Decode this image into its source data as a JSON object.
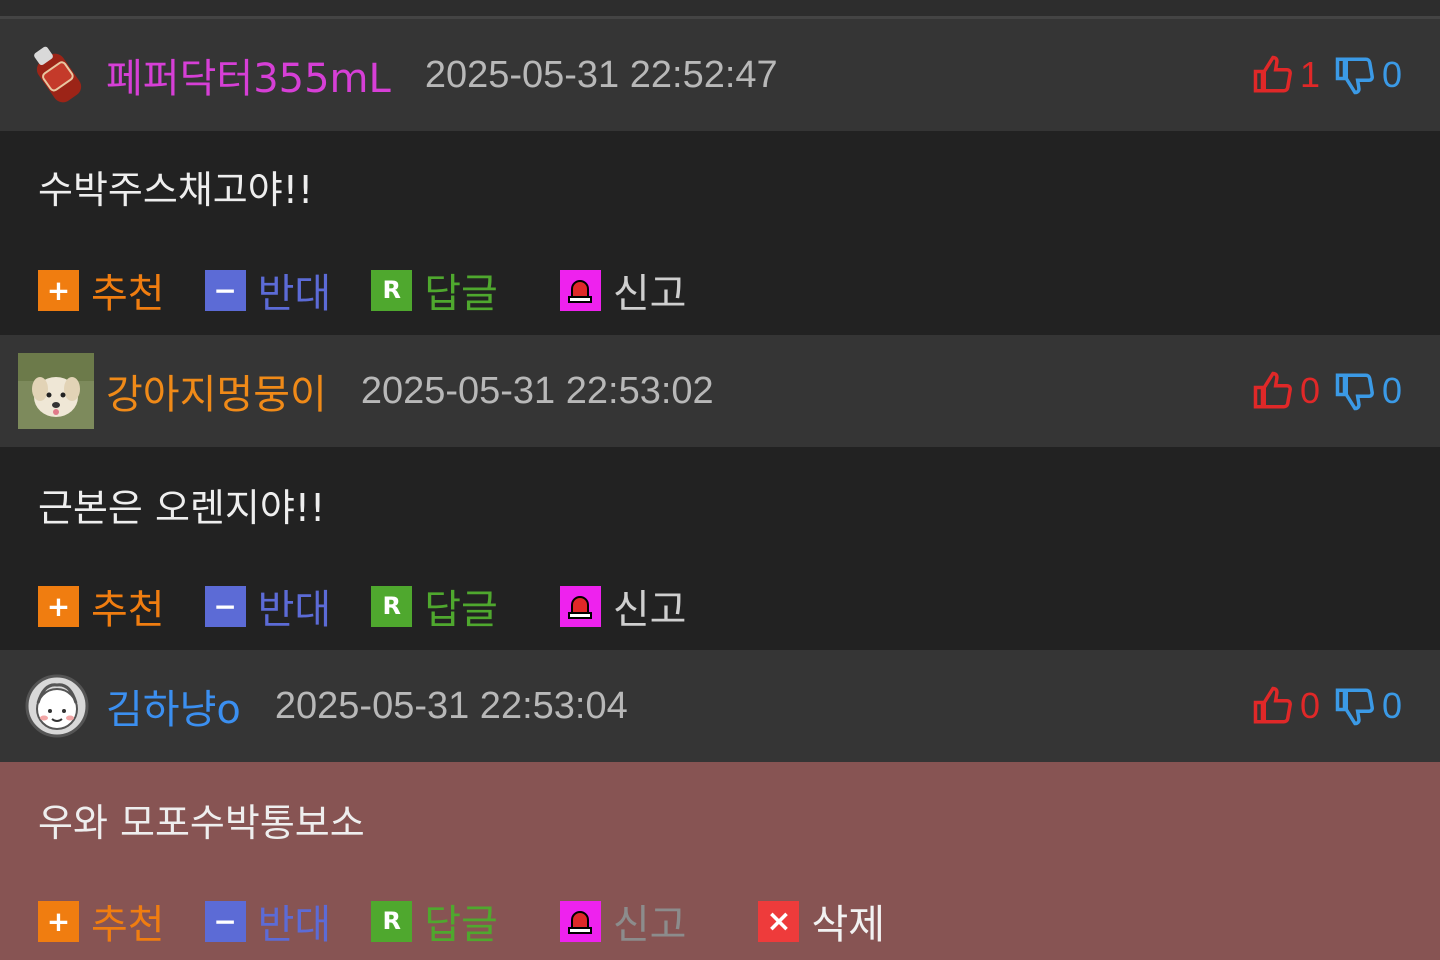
{
  "actions": {
    "recommend": "추천",
    "oppose": "반대",
    "reply": "답글",
    "report": "신고",
    "delete": "삭제"
  },
  "icons": {
    "plus": "plus-icon",
    "minus": "minus-icon",
    "reply": "reply-r-icon",
    "siren": "siren-icon",
    "close": "close-x-icon",
    "thumbs_up": "thumbs-up-icon",
    "thumbs_down": "thumbs-down-icon"
  },
  "colors": {
    "recommend": "#f07d10",
    "oppose": "#5c6bd6",
    "reply": "#4fa82e",
    "report": "#ee22ee",
    "delete": "#ee3b3b",
    "up": "#e02828",
    "down": "#3b9ae6"
  },
  "comments": [
    {
      "author": "페퍼닥터355mL",
      "author_color": "#d63fd6",
      "time": "2025-05-31 22:52:47",
      "up": "1",
      "down": "0",
      "text": "수박주스채고야!!"
    },
    {
      "author": "강아지멍뭉이",
      "author_color": "#f08a18",
      "time": "2025-05-31 22:53:02",
      "up": "0",
      "down": "0",
      "text": "근본은 오렌지야!!"
    },
    {
      "author": "김하냥o",
      "author_color": "#3b8ff0",
      "time": "2025-05-31 22:53:04",
      "up": "0",
      "down": "0",
      "text": "우와 모포수박통보소"
    }
  ]
}
